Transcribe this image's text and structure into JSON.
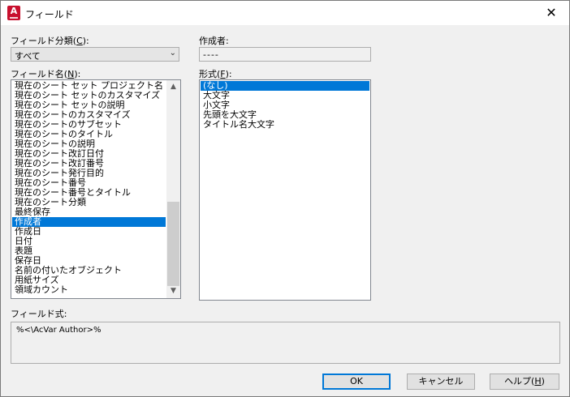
{
  "window": {
    "title": "フィールド",
    "close_icon": "✕"
  },
  "field_category": {
    "label": "フィールド分類(",
    "key": "C",
    "label_end": "):",
    "value": "すべて"
  },
  "author": {
    "label": "作成者:",
    "value": "----"
  },
  "field_names": {
    "label": "フィールド名(",
    "key": "N",
    "label_end": "):",
    "items": [
      "現在のシート セット プロジェクト名",
      "現在のシート セットのカスタマイズ",
      "現在のシート セットの説明",
      "現在のシートのカスタマイズ",
      "現在のシートのサブセット",
      "現在のシートのタイトル",
      "現在のシートの説明",
      "現在のシート改訂日付",
      "現在のシート改訂番号",
      "現在のシート発行目的",
      "現在のシート番号",
      "現在のシート番号とタイトル",
      "現在のシート分類",
      "最終保存",
      "作成者",
      "作成日",
      "日付",
      "表題",
      "保存日",
      "名前の付いたオブジェクト",
      "用紙サイズ",
      "領域カウント"
    ],
    "selected_index": 14
  },
  "format": {
    "label": "形式(",
    "key": "F",
    "label_end": "):",
    "items": [
      "(なし)",
      "大文字",
      "小文字",
      "先頭を大文字",
      "タイトル名大文字"
    ],
    "selected_index": 0
  },
  "field_expression": {
    "label": "フィールド式:",
    "value": "%<\\AcVar Author>%"
  },
  "buttons": {
    "ok": "OK",
    "cancel": "キャンセル",
    "help": "ヘルプ(",
    "help_key": "H",
    "help_end": ")"
  }
}
